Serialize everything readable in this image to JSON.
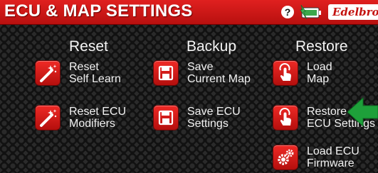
{
  "header": {
    "title": "ECU & MAP SETTINGS",
    "help_label": "?",
    "brand_text": "Edelbrock",
    "accent_color": "#d9201f"
  },
  "columns": {
    "reset": {
      "heading": "Reset",
      "buttons": [
        {
          "line1": "Reset",
          "line2": "Self Learn",
          "icon": "wand-icon"
        },
        {
          "line1": "Reset ECU",
          "line2": "Modifiers",
          "icon": "wand-icon"
        }
      ]
    },
    "backup": {
      "heading": "Backup",
      "buttons": [
        {
          "line1": "Save",
          "line2": "Current Map",
          "icon": "floppy-disk-icon"
        },
        {
          "line1": "Save ECU",
          "line2": "Settings",
          "icon": "floppy-disk-icon"
        }
      ]
    },
    "restore": {
      "heading": "Restore",
      "buttons": [
        {
          "line1": "Load",
          "line2": "Map",
          "icon": "touch-hand-icon"
        },
        {
          "line1": "Restore",
          "line2": "ECU Settings",
          "icon": "touch-hand-icon"
        },
        {
          "line1": "Load ECU",
          "line2": "Firmware",
          "icon": "gears-icon"
        }
      ]
    }
  },
  "icons": {
    "help": "help-icon",
    "battery": "battery-charging-icon",
    "arrow": "green-arrow-icon"
  },
  "colors": {
    "button_red": "#e0201f",
    "arrow_green": "#1ea03a"
  }
}
